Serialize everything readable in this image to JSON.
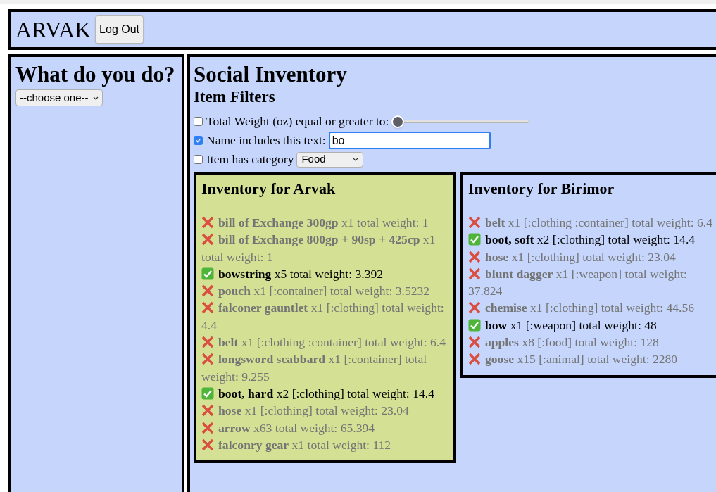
{
  "header": {
    "title": "ARVAK",
    "logout_button": "Log Out"
  },
  "actions": {
    "heading": "What do you do?",
    "select": {
      "value": "--choose one--"
    }
  },
  "main": {
    "title": "Social Inventory",
    "filters_heading": "Item Filters",
    "filters": [
      {
        "kind": "slider",
        "label": "Total Weight (oz) equal or greater to:",
        "checked": false,
        "level": 0
      },
      {
        "kind": "text",
        "label": "Name includes this text:",
        "checked": true,
        "value": "bo"
      },
      {
        "kind": "select",
        "label": "Item has category",
        "checked": false,
        "value": "Food"
      }
    ],
    "inventories": [
      {
        "title": "Inventory for Arvak",
        "highlighted": true,
        "items": [
          {
            "match": false,
            "name": "bill of Exchange 300gp",
            "qty": "x1",
            "weight": "total weight: 1"
          },
          {
            "match": false,
            "name": "bill of Exchange 800gp + 90sp + 425cp",
            "qty": "x1",
            "weight": "total weight: 1"
          },
          {
            "match": true,
            "name": "bowstring",
            "qty": "x5",
            "weight": "total weight: 3.392"
          },
          {
            "match": false,
            "name": "pouch",
            "qty": "x1",
            "category": "[:container]",
            "weight": "total weight: 3.5232"
          },
          {
            "match": false,
            "name": "falconer gauntlet",
            "qty": "x1",
            "category": "[:clothing]",
            "weight": "total weight: 4.4"
          },
          {
            "match": false,
            "name": "belt",
            "qty": "x1",
            "category": "[:clothing :container]",
            "weight": "total weight: 6.4"
          },
          {
            "match": false,
            "name": "longsword scabbard",
            "qty": "x1",
            "category": "[:container]",
            "weight": "total weight: 9.255"
          },
          {
            "match": true,
            "name": "boot, hard",
            "qty": "x2",
            "category": "[:clothing]",
            "weight": "total weight: 14.4"
          },
          {
            "match": false,
            "name": "hose",
            "qty": "x1",
            "category": "[:clothing]",
            "weight": "total weight: 23.04"
          },
          {
            "match": false,
            "name": "arrow",
            "qty": "x63",
            "weight": "total weight: 65.394"
          },
          {
            "match": false,
            "name": "falconry gear",
            "qty": "x1",
            "weight": "total weight: 112"
          }
        ]
      },
      {
        "title": "Inventory for Birimor",
        "highlighted": false,
        "items": [
          {
            "match": false,
            "name": "belt",
            "qty": "x1",
            "category": "[:clothing :container]",
            "weight": "total weight: 6.4"
          },
          {
            "match": true,
            "name": "boot, soft",
            "qty": "x2",
            "category": "[:clothing]",
            "weight": "total weight: 14.4"
          },
          {
            "match": false,
            "name": "hose",
            "qty": "x1",
            "category": "[:clothing]",
            "weight": "total weight: 23.04"
          },
          {
            "match": false,
            "name": "blunt dagger",
            "qty": "x1",
            "category": "[:weapon]",
            "weight": "total weight: 37.824"
          },
          {
            "match": false,
            "name": "chemise",
            "qty": "x1",
            "category": "[:clothing]",
            "weight": "total weight: 44.56"
          },
          {
            "match": true,
            "name": "bow",
            "qty": "x1",
            "category": "[:weapon]",
            "weight": "total weight: 48"
          },
          {
            "match": false,
            "name": "apples",
            "qty": "x8",
            "category": "[:food]",
            "weight": "total weight: 128"
          },
          {
            "match": false,
            "name": "goose",
            "qty": "x15",
            "category": "[:animal]",
            "weight": "total weight: 2280"
          }
        ]
      }
    ]
  }
}
